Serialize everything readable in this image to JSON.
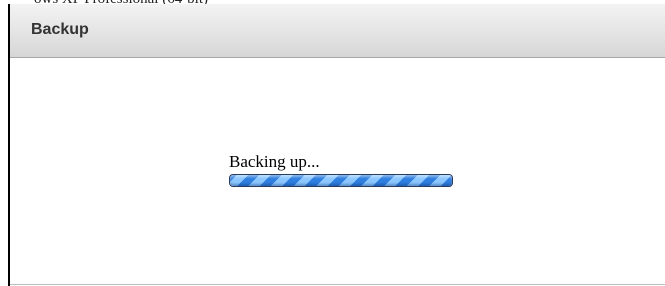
{
  "background_window": {
    "partial_text": "ows XP Professional (64-bit)"
  },
  "dialog": {
    "title": "Backup",
    "status_text": "Backing up...",
    "progress": {
      "fraction": 1.0,
      "indeterminate": true,
      "bar_color": "#2f7fe0",
      "stripe_color": "#8cc8ff"
    }
  }
}
